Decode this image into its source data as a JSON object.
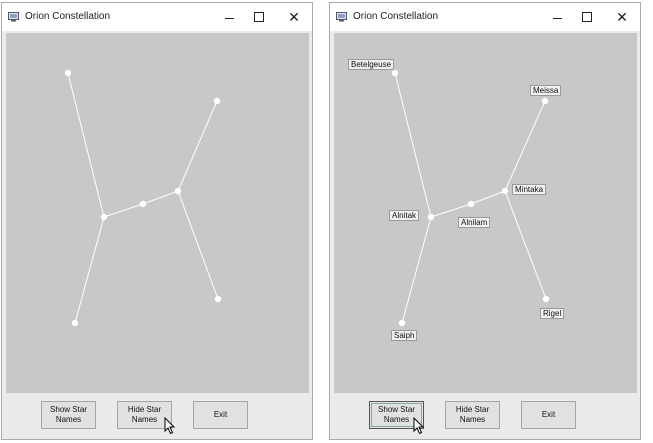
{
  "windows": [
    {
      "title": "Orion Constellation",
      "buttons": {
        "show": "Show Star Names",
        "hide": "Hide Star Names",
        "exit": "Exit"
      }
    },
    {
      "title": "Orion Constellation",
      "buttons": {
        "show": "Show Star Names",
        "hide": "Hide Star Names",
        "exit": "Exit"
      },
      "star_labels": {
        "betelgeuse": "Betelgeuse",
        "meissa": "Meissa",
        "mintaka": "Mintaka",
        "alnitak": "Alnitak",
        "alnilam": "Alnilam",
        "rigel": "Rigel",
        "saiph": "Saiph"
      }
    }
  ],
  "colors": {
    "canvas": "#c8c8ca",
    "star": "#ffffff",
    "line": "#ffffff"
  },
  "icons": [
    "app-icon",
    "minimize-icon",
    "maximize-icon",
    "close-icon",
    "mouse-cursor-icon"
  ]
}
